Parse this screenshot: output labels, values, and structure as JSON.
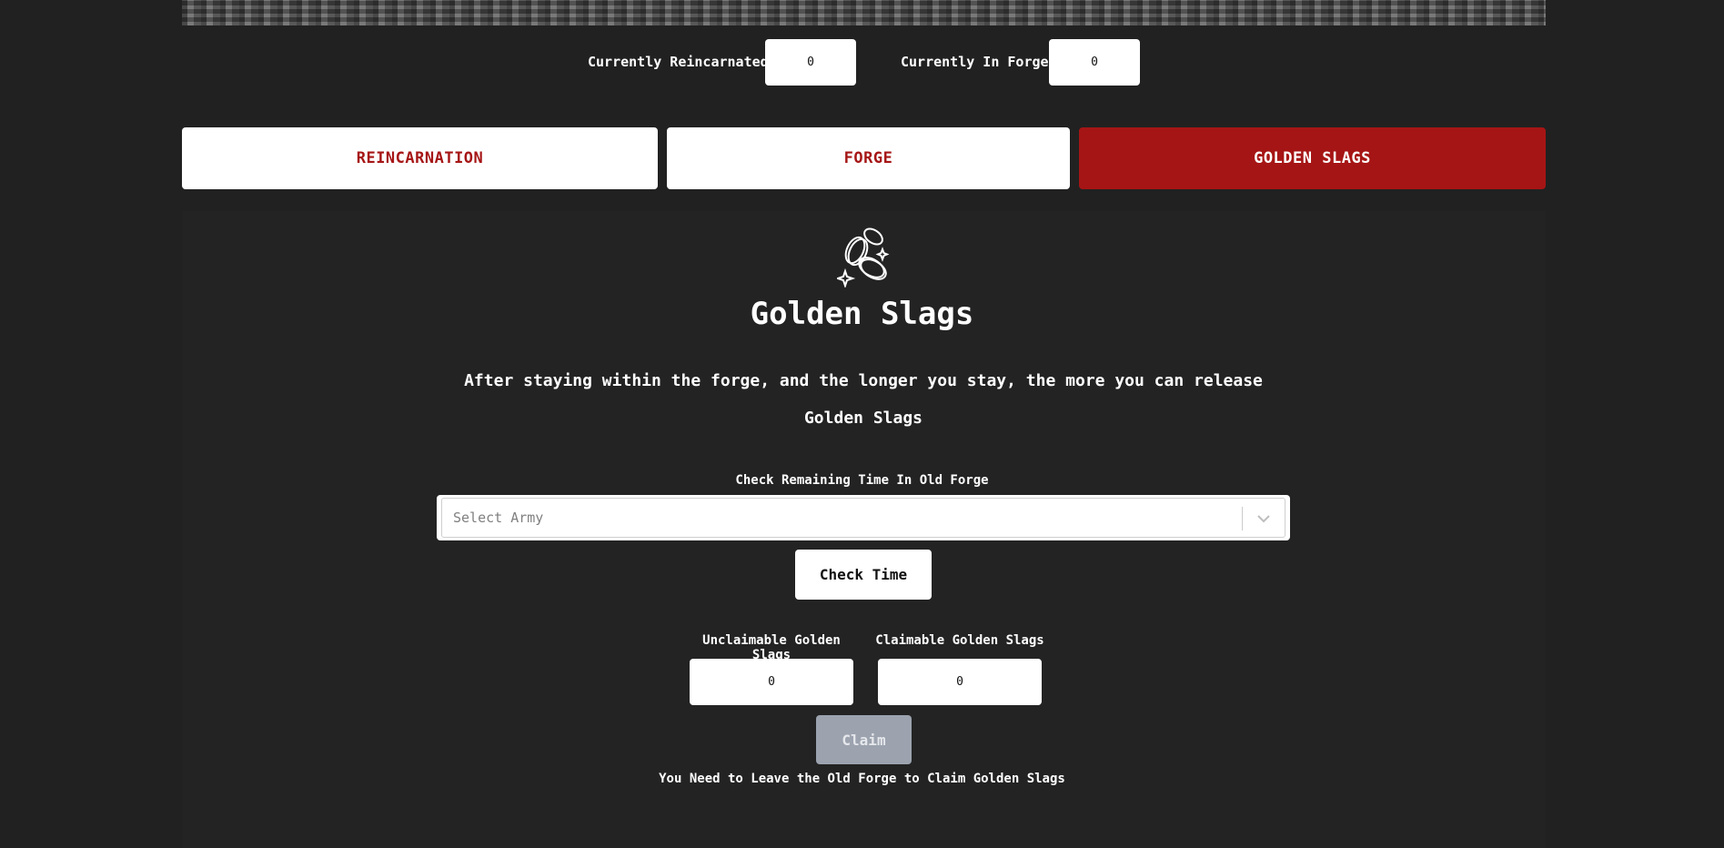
{
  "counters": {
    "reincarnated_label": "Currently Reincarnated:",
    "reincarnated_value": "0",
    "forge_label": "Currently In Forge:",
    "forge_value": "0"
  },
  "tabs": [
    {
      "label": "REINCARNATION",
      "active": false
    },
    {
      "label": "FORGE",
      "active": false
    },
    {
      "label": "GOLDEN SLAGS",
      "active": true
    }
  ],
  "section": {
    "icon": "coins-icon",
    "title": "Golden Slags",
    "description": "After staying within the forge, and the longer you stay, the more you can release Golden Slags"
  },
  "check": {
    "label": "Check Remaining Time In Old Forge",
    "select_placeholder": "Select Army",
    "button_label": "Check Time"
  },
  "slags": {
    "unclaimable_label": "Unclaimable Golden Slags",
    "unclaimable_value": "0",
    "claimable_label": "Claimable Golden Slags",
    "claimable_value": "0",
    "claim_label": "Claim",
    "note": "You Need to Leave the Old Forge to Claim Golden Slags"
  },
  "colors": {
    "background": "#212121",
    "accent_red": "#a61515",
    "disabled": "#9ca3af"
  }
}
